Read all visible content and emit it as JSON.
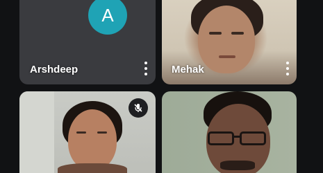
{
  "participants": [
    {
      "name": "Arshdeep",
      "avatar_letter": "A",
      "avatar_color": "#1fa3b5",
      "video": false
    },
    {
      "name": "Mehak",
      "video": true
    },
    {
      "name": "",
      "video": true,
      "muted": true
    },
    {
      "name": "",
      "video": true
    }
  ],
  "icons": {
    "more": "more-vert-icon",
    "mute": "mic-off-icon"
  }
}
